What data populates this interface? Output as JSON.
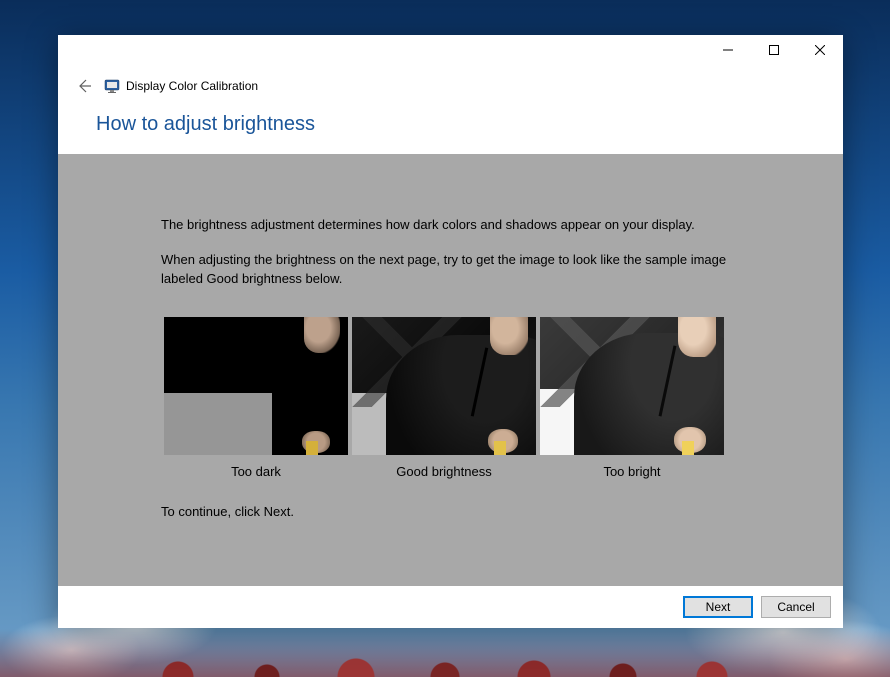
{
  "window": {
    "app_title": "Display Color Calibration",
    "heading": "How to adjust brightness"
  },
  "content": {
    "paragraph1": "The brightness adjustment determines how dark colors and shadows appear on your display.",
    "paragraph2": "When adjusting the brightness on the next page, try to get the image to look like the sample image labeled Good brightness below.",
    "samples": {
      "too_dark": "Too dark",
      "good": "Good brightness",
      "too_bright": "Too bright"
    },
    "continue_text": "To continue, click Next."
  },
  "footer": {
    "next": "Next",
    "cancel": "Cancel"
  }
}
